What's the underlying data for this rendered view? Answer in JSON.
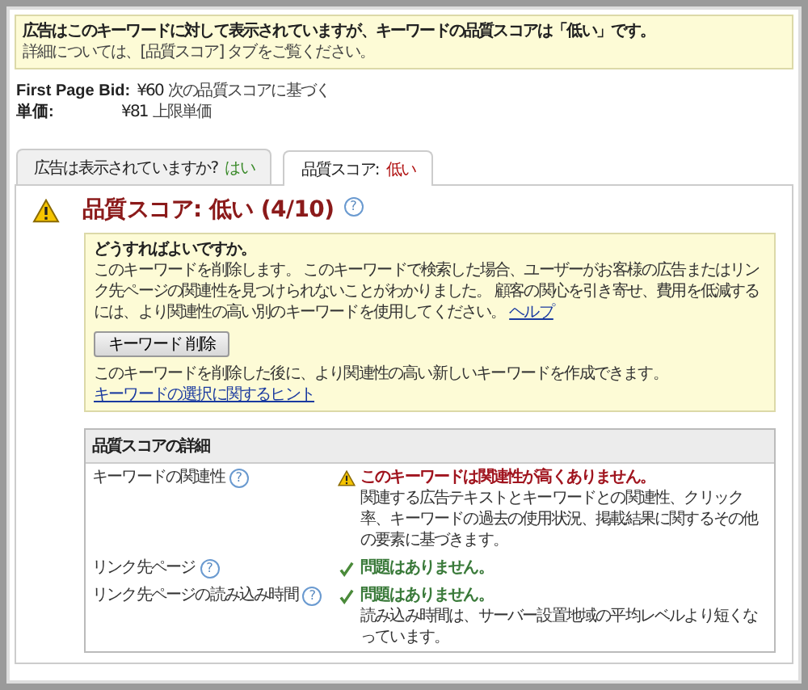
{
  "notice": {
    "headline": "広告はこのキーワードに対して表示されていますが、キーワードの品質スコアは「低い」です。",
    "detail": "詳細については、[品質スコア] タブをご覧ください。"
  },
  "bids": [
    {
      "label": "First Page Bid:",
      "value": "¥60",
      "note": "次の品質スコアに基づく"
    },
    {
      "label": "単価:",
      "value": "¥81",
      "note": "上限単価"
    }
  ],
  "tabs": [
    {
      "label": "広告は表示されていますか?",
      "value": "はい",
      "kind": "good",
      "selected": false
    },
    {
      "label": "品質スコア:",
      "value": "低い",
      "kind": "bad",
      "selected": true
    }
  ],
  "score": {
    "title": "品質スコア: 低い (4/10)",
    "help_icon": "?"
  },
  "advice": {
    "heading": "どうすればよいですか。",
    "body": "このキーワードを削除します。 このキーワードで検索した場合、ユーザーがお客様の広告またはリンク先ページの関連性を見つけられないことがわかりました。 顧客の関心を引き寄せ、費用を低減するには、より関連性の高い別のキーワードを使用してください。",
    "help_link": "ヘルプ",
    "button": "キーワード 削除",
    "footer": "このキーワードを削除した後に、より関連性の高い新しいキーワードを作成できます。",
    "tips_link": "キーワードの選択に関するヒント"
  },
  "details": {
    "heading": "品質スコアの詳細",
    "rows": [
      {
        "label": "キーワードの関連性",
        "help_icon": "?",
        "kind": "warning",
        "verdict": "このキーワードは関連性が高くありません。",
        "explanation": "関連する広告テキストとキーワードとの関連性、クリック率、キーワードの過去の使用状況、掲載結果に関するその他の要素に基づきます。"
      },
      {
        "label": "リンク先ページ",
        "help_icon": "?",
        "kind": "ok",
        "verdict": "問題はありません。"
      },
      {
        "label": "リンク先ページの読み込み時間",
        "help_icon": "?",
        "kind": "ok",
        "verdict": "問題はありません。",
        "explanation": "読み込み時間は、サーバー設置地域の平均レベルより短くなっています。"
      }
    ]
  }
}
